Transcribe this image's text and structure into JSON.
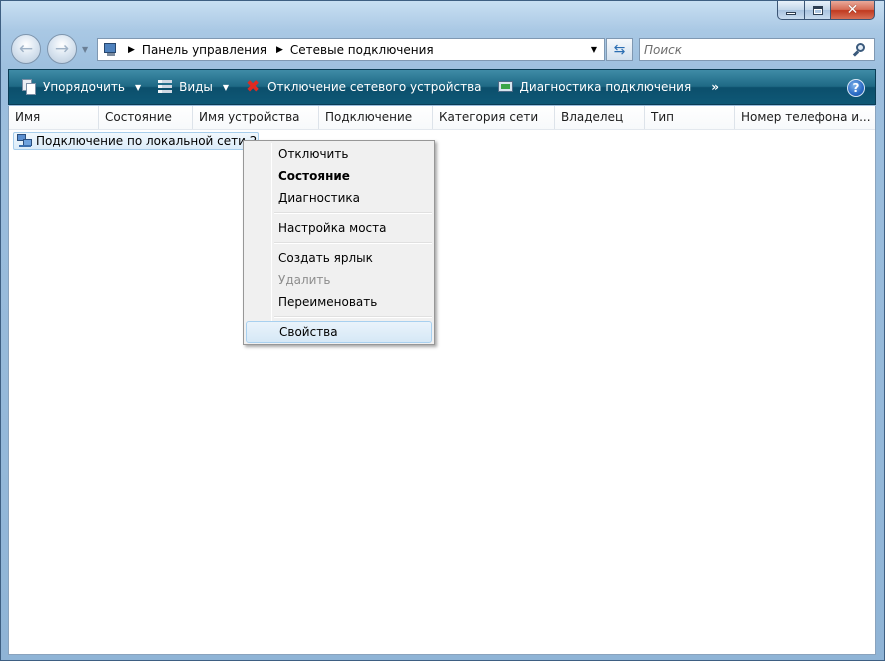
{
  "window": {
    "caption_buttons": [
      "minimize-icon",
      "maximize-icon",
      "close-icon"
    ],
    "close_glyph": "✕"
  },
  "nav": {
    "back_icon": "back-arrow-icon",
    "forward_icon": "forward-arrow-icon",
    "back_glyph": "←",
    "forward_glyph": "→",
    "history_glyph": "▼"
  },
  "address": {
    "location_icon": "control-panel-icon",
    "crumb_sep": "▶",
    "crumbs": [
      "Панель управления",
      "Сетевые подключения"
    ],
    "dropdown_glyph": "▼",
    "refresh_glyph": "⇆"
  },
  "search": {
    "placeholder": "Поиск",
    "icon": "search-icon"
  },
  "toolbar": {
    "organize_label": "Упорядочить",
    "views_label": "Виды",
    "disconnect_label": "Отключение сетевого устройства",
    "diagnose_label": "Диагностика подключения",
    "more_label": "»",
    "caret_glyph": "▼",
    "disconnect_glyph": "✖",
    "help_label": "?",
    "colors": {
      "bar_top": "#3f8ba6",
      "bar_bottom": "#0e5876",
      "disconnect": "#e02a20"
    }
  },
  "columns": [
    "Имя",
    "Состояние",
    "Имя устройства",
    "Подключение",
    "Категория сети",
    "Владелец",
    "Тип",
    "Номер телефона и..."
  ],
  "items": [
    {
      "label": "Подключение по локальной сети 2",
      "icon": "network-connection-icon"
    }
  ],
  "context_menu": {
    "items": [
      {
        "label": "Отключить"
      },
      {
        "label": "Состояние"
      },
      {
        "label": "Диагностика"
      },
      {
        "label": "Настройка моста"
      },
      {
        "label": "Создать ярлык"
      },
      {
        "label": "Удалить"
      },
      {
        "label": "Переименовать"
      },
      {
        "label": "Свойства"
      }
    ]
  }
}
